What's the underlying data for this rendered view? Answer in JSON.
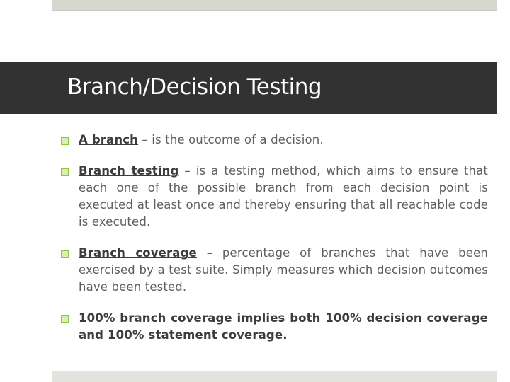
{
  "slide": {
    "title": "Branch/Decision Testing",
    "accent_color": "#8dc63f",
    "title_bar_color": "#323232",
    "bullets": [
      {
        "term": "A branch",
        "text": " – is the outcome of a decision."
      },
      {
        "term": "Branch testing",
        "text": " – is a testing method, which aims to ensure that each one of the possible branch from each decision point is executed at least once and thereby ensuring that all reachable code is executed."
      },
      {
        "term": "Branch coverage",
        "text": " – percentage of branches that have been exercised by a test suite. Simply measures which decision outcomes have been tested."
      },
      {
        "term": "100% branch coverage implies both 100% decision coverage and 100% statement coverage",
        "text": "."
      }
    ]
  }
}
